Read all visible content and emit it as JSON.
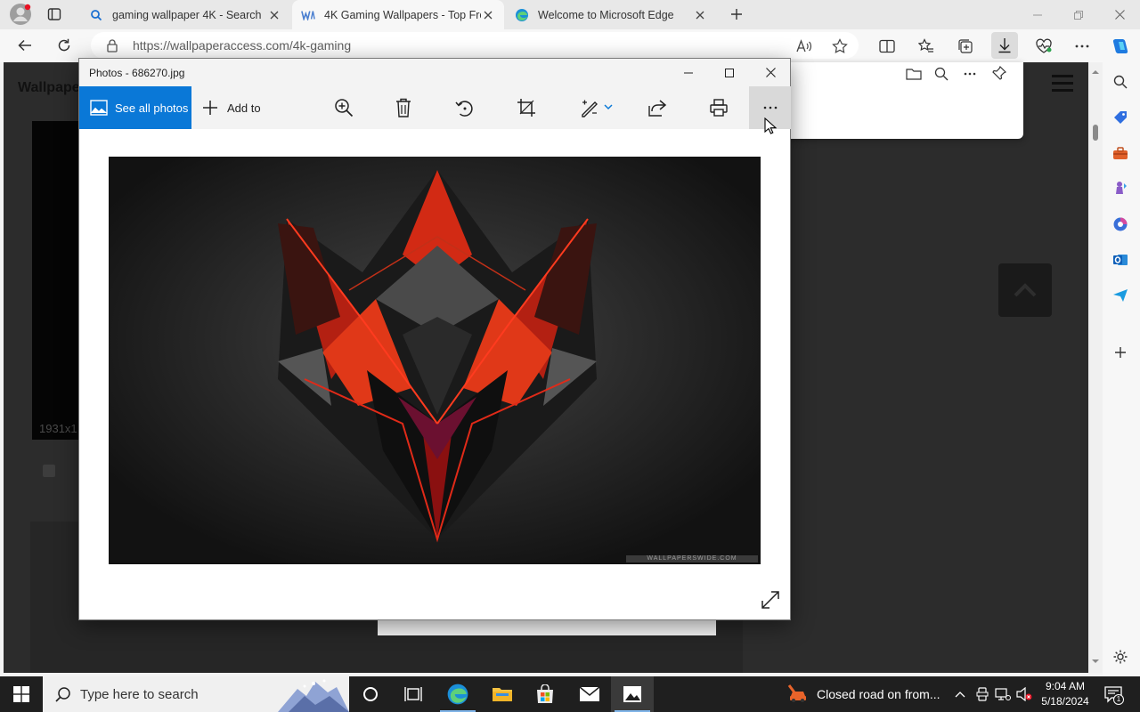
{
  "browser": {
    "tabs": [
      {
        "title": "gaming wallpaper 4K - Search",
        "icon": "search-icon",
        "active": false
      },
      {
        "title": "4K Gaming Wallpapers - Top Fre",
        "icon": "wallpaperaccess-icon",
        "active": true
      },
      {
        "title": "Welcome to Microsoft Edge",
        "icon": "edge-icon",
        "active": false
      }
    ],
    "url": "https://wallpaperaccess.com/4k-gaming"
  },
  "page": {
    "header_partial": "Wallpape",
    "resolution_partial": "1931x1",
    "accent": "#0a78d7"
  },
  "photos": {
    "window_title": "Photos - 686270.jpg",
    "see_all_label": "See all photos",
    "add_to_label": "Add to",
    "watermark": "WALLPAPERSWIDE.COM"
  },
  "taskbar": {
    "search_placeholder": "Type here to search",
    "news_text": "Closed road on from...",
    "time": "9:04 AM",
    "date": "5/18/2024",
    "notification_count": "1"
  }
}
